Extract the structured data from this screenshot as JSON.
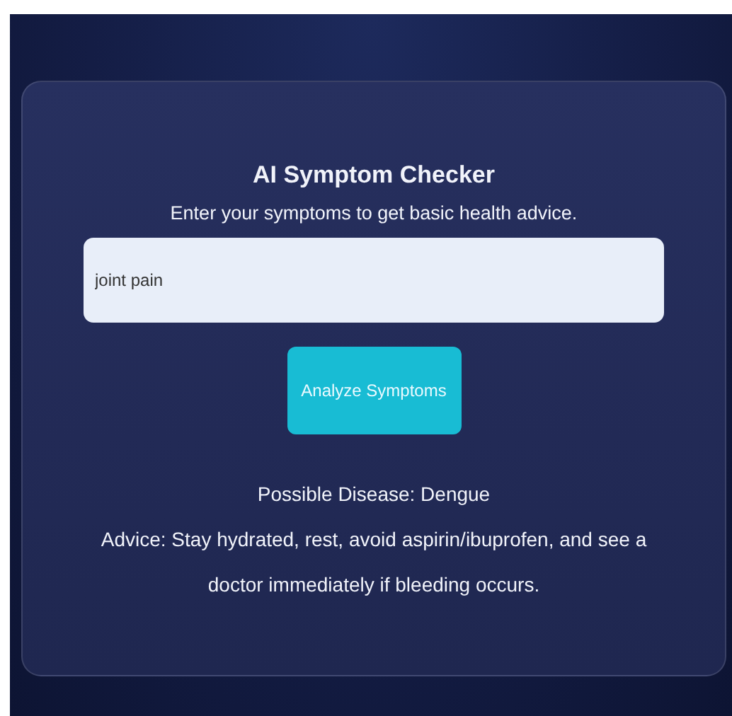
{
  "title": "AI Symptom Checker",
  "subtitle": "Enter your symptoms to get basic health advice.",
  "symptom_input": {
    "value": "joint pain"
  },
  "button": {
    "label": "Analyze Symptoms"
  },
  "result": {
    "disease": "Possible Disease: Dengue",
    "advice": "Advice: Stay hydrated, rest, avoid aspirin/ibuprofen, and see a doctor immediately if bleeding occurs."
  }
}
